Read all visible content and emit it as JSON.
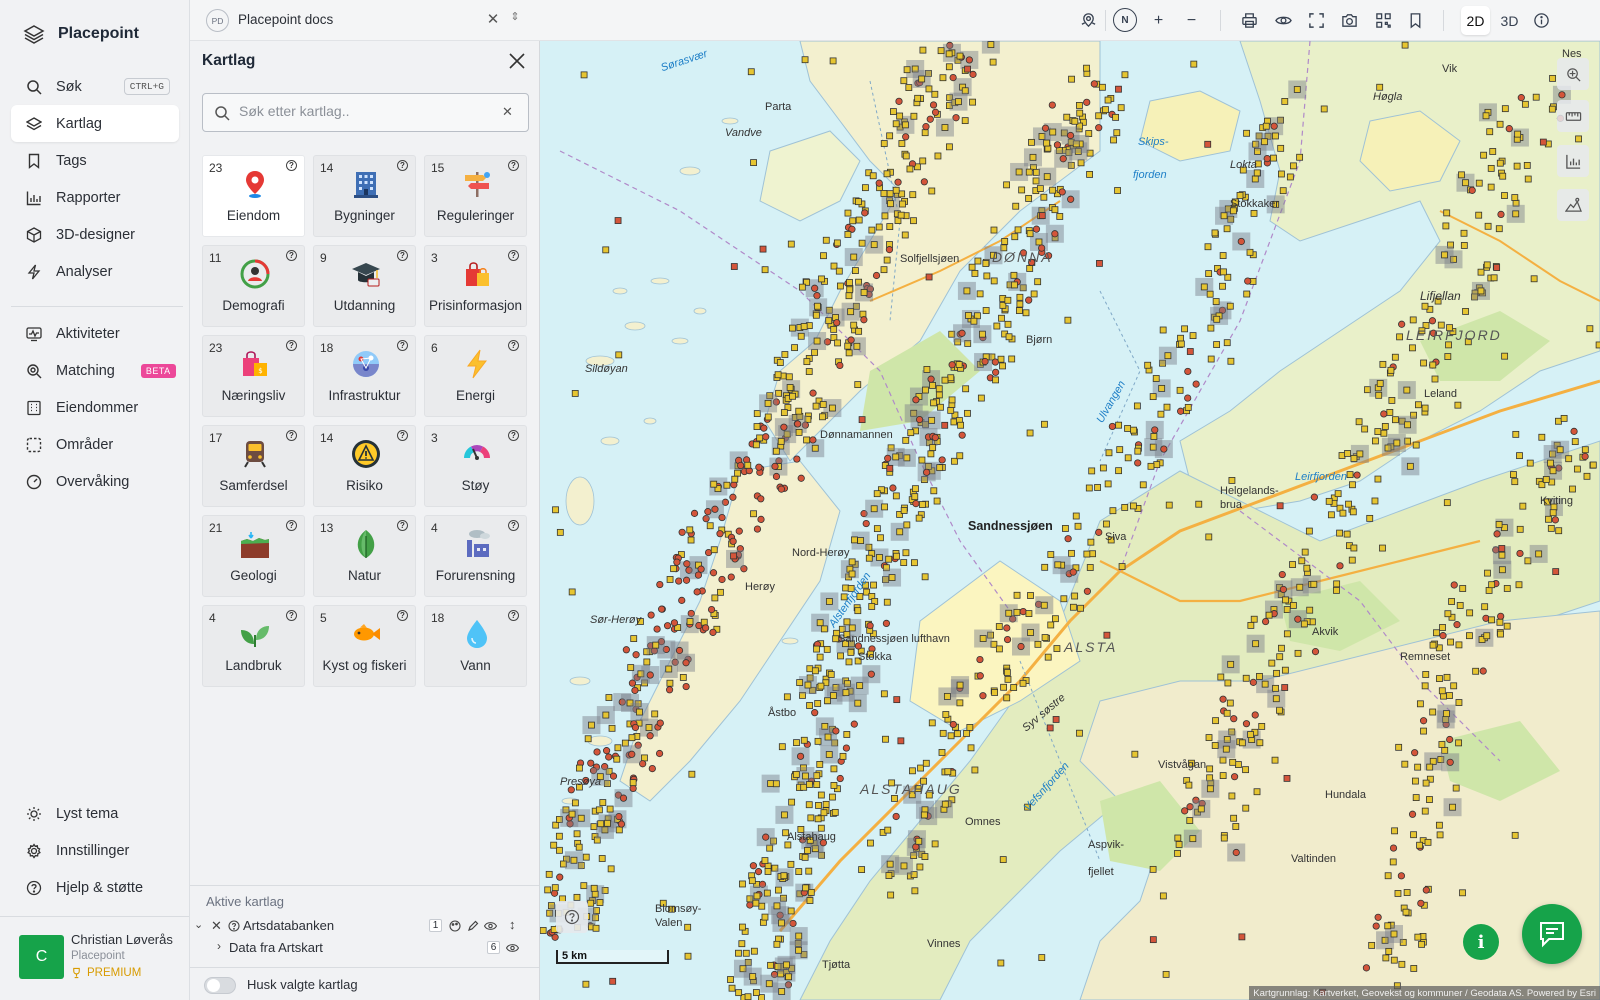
{
  "app": {
    "name": "Placepoint"
  },
  "sidebar": {
    "items": [
      {
        "label": "Søk",
        "icon": "search-icon",
        "shortcut": "CTRL+G"
      },
      {
        "label": "Kartlag",
        "icon": "layers-icon",
        "active": true
      },
      {
        "label": "Tags",
        "icon": "bookmark-icon"
      },
      {
        "label": "Rapporter",
        "icon": "bar-chart-icon"
      },
      {
        "label": "3D-designer",
        "icon": "cube-icon"
      },
      {
        "label": "Analyser",
        "icon": "lightning-icon"
      },
      {
        "label": "Aktiviteter",
        "icon": "activity-icon"
      },
      {
        "label": "Matching",
        "icon": "zoom-search-icon",
        "badge": "BETA"
      },
      {
        "label": "Eiendommer",
        "icon": "building-icon"
      },
      {
        "label": "Områder",
        "icon": "dashed-square-icon"
      },
      {
        "label": "Overvåking",
        "icon": "gauge-icon"
      }
    ],
    "bottom": [
      {
        "label": "Lyst tema",
        "icon": "sun-icon"
      },
      {
        "label": "Innstillinger",
        "icon": "gear-icon"
      },
      {
        "label": "Hjelp & støtte",
        "icon": "help-circle-icon"
      }
    ],
    "user": {
      "initial": "C",
      "name": "Christian Løverås",
      "org": "Placepoint",
      "plan": "PREMIUM"
    }
  },
  "topbar": {
    "doc_badge": "PD",
    "doc_name": "Placepoint docs",
    "compass_label": "N",
    "mode_2d": "2D",
    "mode_3d": "3D"
  },
  "panel": {
    "title": "Kartlag",
    "search_placeholder": "Søk etter kartlag..",
    "categories": [
      {
        "count": "23",
        "label": "Eiendom",
        "icon": "location-pin-icon",
        "active": true
      },
      {
        "count": "14",
        "label": "Bygninger",
        "icon": "office-building-icon"
      },
      {
        "count": "15",
        "label": "Reguleringer",
        "icon": "signpost-icon"
      },
      {
        "count": "11",
        "label": "Demografi",
        "icon": "people-circle-icon"
      },
      {
        "count": "9",
        "label": "Utdanning",
        "icon": "graduation-cap-icon"
      },
      {
        "count": "3",
        "label": "Prisinformasjon",
        "icon": "shopping-bag-icon"
      },
      {
        "count": "23",
        "label": "Næringsliv",
        "icon": "shopping-bags-icon"
      },
      {
        "count": "18",
        "label": "Infrastruktur",
        "icon": "network-globe-icon"
      },
      {
        "count": "6",
        "label": "Energi",
        "icon": "lightning-bolt-icon"
      },
      {
        "count": "17",
        "label": "Samferdsel",
        "icon": "train-icon"
      },
      {
        "count": "14",
        "label": "Risiko",
        "icon": "warning-gauge-icon"
      },
      {
        "count": "3",
        "label": "Støy",
        "icon": "noise-gauge-icon"
      },
      {
        "count": "21",
        "label": "Geologi",
        "icon": "soil-layers-icon"
      },
      {
        "count": "13",
        "label": "Natur",
        "icon": "leaf-icon"
      },
      {
        "count": "4",
        "label": "Forurensning",
        "icon": "factory-icon"
      },
      {
        "count": "4",
        "label": "Landbruk",
        "icon": "sprout-icon"
      },
      {
        "count": "5",
        "label": "Kyst og fiskeri",
        "icon": "fish-icon"
      },
      {
        "count": "18",
        "label": "Vann",
        "icon": "water-drop-icon"
      }
    ],
    "active_title": "Aktive kartlag",
    "active_layers": [
      {
        "name": "Artsdatabanken",
        "count": "1"
      },
      {
        "name": "Data fra Artskart",
        "count": "6"
      }
    ],
    "remember_label": "Husk valgte kartlag"
  },
  "map": {
    "labels": {
      "sorasvaer": "Sørasvær",
      "parta": "Parta",
      "vandve": "Vandve",
      "skipsfjorden1": "Skips-",
      "skipsfjorden2": "fjorden",
      "lokta": "Lokta",
      "stokkaker": "Stokkaker",
      "solfjellsjoen": "Solfjellsjøen",
      "donna": "DØNNA",
      "lifjellan": "Lifjellan",
      "leirfjord_region": "LEIRFJORD",
      "sildoyan": "Sildøyan",
      "bjorn": "Bjørn",
      "ulvangen": "Ulvangen",
      "dalsvannet": "Dønnamannen",
      "leland": "Leland",
      "helgelandsbrua1": "Helgelands-",
      "helgelandsbrua2": "brua",
      "leirfjorden": "Leirfjorden",
      "kvitingen": "Kviting",
      "sandnessjoen": "Sandnessjøen",
      "siva": "Siva",
      "nord_heroy": "Nord-Herøy",
      "alstenfjorden": "Alstenfjorden",
      "heroy": "Herøy",
      "sor_heroy": "Sør-Herøy",
      "sandnessjoen_lufthavn": "Sandnessjøen lufthavn",
      "stokka": "Stokka",
      "alsta": "ALSTA",
      "akvik": "Akvik",
      "remneset": "Remneset",
      "syv_sostre": "Syv søstre",
      "astbo": "Åstbo",
      "presoya": "Presøya",
      "vistvagan": "Vistvågan",
      "hundala": "Hundala",
      "vefsnfjorden": "Vefsnfjorden",
      "alstahaug": "ALSTAHAUG",
      "alstahaug_village": "Alstahaug",
      "tjotta_n": "Omnes",
      "aspvik1": "Aspvik-",
      "aspvik2": "fjellet",
      "valtinden": "Valtinden",
      "blomsoy1": "Blomsøy-",
      "blomsoy2": "Valen",
      "vinnes": "Vinnes",
      "tjotta": "Tjøtta",
      "hogla": "Høgla",
      "vik": "Vik",
      "nes": "Nes"
    },
    "scale_label": "5 km",
    "attribution": "Kartgrunnlag: Kartverket, Geovekst og kommuner / Geodata AS. Powered by Esri"
  },
  "colors": {
    "accent": "#16a34a",
    "beta": "#ec4899",
    "premium": "#d89b00",
    "sea": "#d6f1f6",
    "land": "#f3f0cf",
    "marker_yellow": "#e6c531",
    "marker_red": "#d4553a"
  }
}
